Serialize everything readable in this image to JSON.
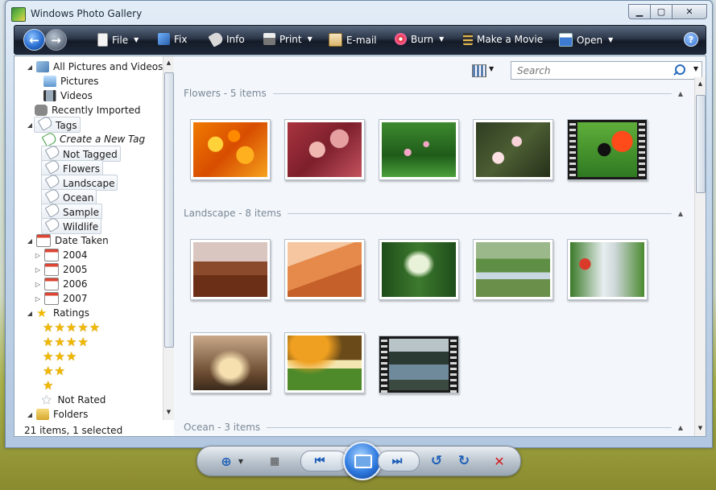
{
  "window": {
    "title": "Windows Photo Gallery"
  },
  "toolbar": {
    "file": "File",
    "fix": "Fix",
    "info": "Info",
    "print": "Print",
    "email": "E-mail",
    "burn": "Burn",
    "make_movie": "Make a Movie",
    "open": "Open",
    "help": "?"
  },
  "nav": {
    "all": "All Pictures and Videos",
    "pictures": "Pictures",
    "videos": "Videos",
    "recent": "Recently Imported",
    "tags": "Tags",
    "create_tag": "Create a New Tag",
    "tag_items": [
      "Not Tagged",
      "Flowers",
      "Landscape",
      "Ocean",
      "Sample",
      "Wildlife"
    ],
    "date_taken": "Date Taken",
    "years": [
      "2004",
      "2005",
      "2006",
      "2007"
    ],
    "ratings": "Ratings",
    "star_rows": [
      5,
      4,
      3,
      2,
      1
    ],
    "not_rated": "Not Rated",
    "folders": "Folders"
  },
  "status": {
    "text": "21 items, 1 selected"
  },
  "search": {
    "placeholder": "Search"
  },
  "groups": [
    {
      "label": "Flowers - 5 items"
    },
    {
      "label": "Landscape - 8 items"
    },
    {
      "label": "Ocean - 3 items"
    }
  ],
  "colors": {
    "toolbar_dark": "#141b28",
    "accent_blue": "#2f7ae0",
    "star_gold": "#f0b800"
  }
}
